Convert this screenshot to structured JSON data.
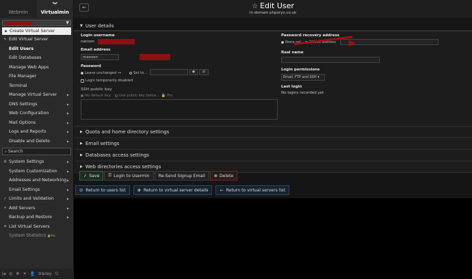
{
  "sidebar": {
    "tabs": [
      "Webmin",
      "Virtualmin"
    ],
    "create_label": "Create Virtual Server",
    "items": [
      "Edit Virtual Server",
      "Edit Users",
      "Edit Databases",
      "Manage Web Apps",
      "File Manager",
      "Terminal",
      "Manage Virtual Server",
      "DNS Settings",
      "Web Configuration",
      "Mail Options",
      "Logs and Reports",
      "Disable and Delete"
    ],
    "search_label": "Search",
    "items2": [
      "System Settings",
      "System Customization",
      "Addresses and Networking",
      "Email Settings",
      "Limits and Validation",
      "Add Servers",
      "Backup and Restore",
      "List Virtual Servers",
      "System Statistics"
    ],
    "pro_tag": "Pro",
    "user": "tracey"
  },
  "header": {
    "title": "Edit User",
    "subtitle": "In domain phporyx.co.uk"
  },
  "user_details": {
    "section_title": "User details",
    "login_username_label": "Login username",
    "login_username_value": "nanson",
    "email_label": "Email address",
    "email_value": "manson",
    "password_label": "Password",
    "pw_unchanged": "Leave unchanged",
    "pw_set": "Set to ..",
    "temp_disabled": "Login temporarily disabled",
    "ssh_label": "SSH public key",
    "ssh_no_default": "No default key",
    "ssh_use_below": "Use public key below ..",
    "ssh_pro": "Pro",
    "recovery_label": "Password recovery address",
    "recovery_none": "None set",
    "recovery_offsite": "Offsite address",
    "realname_label": "Real name",
    "perm_label": "Login permissions",
    "perm_value": "Email, FTP and SSH",
    "lastlogin_label": "Last login",
    "lastlogin_value": "No logins recorded yet"
  },
  "collapsed_sections": [
    "Quota and home directory settings",
    "Email settings",
    "Databases access settings",
    "Web directories access settings"
  ],
  "actions": [
    "Save",
    "Login to Usermin",
    "Re-Send Signup Email",
    "Delete"
  ],
  "nav_buttons": [
    "Return to users list",
    "Return to virtual server details",
    "Return to virtual servers list"
  ]
}
